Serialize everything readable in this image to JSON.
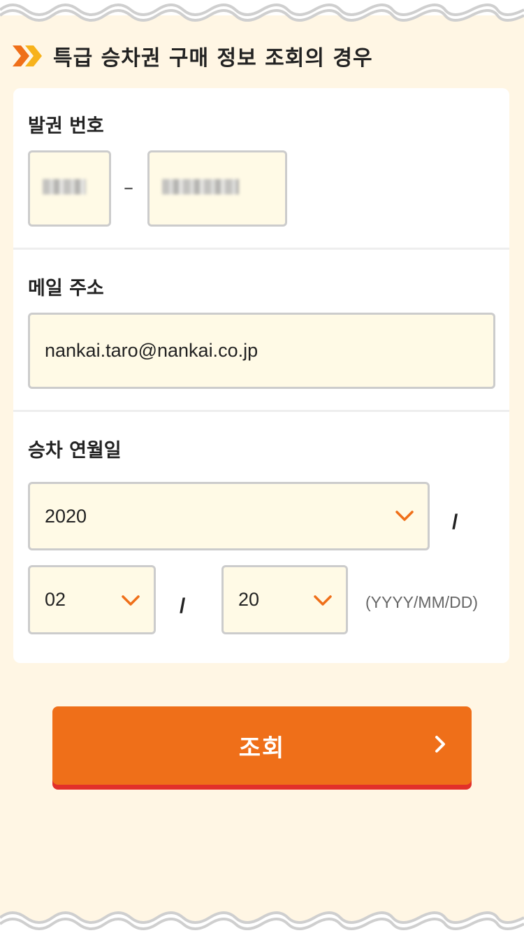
{
  "page": {
    "section_title": "특급 승차권 구매 정보 조회의 경우",
    "colors": {
      "accent": "#ef6f19",
      "accent_shadow": "#e2302a",
      "background": "#fff6e4",
      "field_bg": "#fffae6"
    }
  },
  "form": {
    "ticket_number": {
      "label": "발권 번호",
      "separator": "–",
      "part1_value": "",
      "part2_value": ""
    },
    "email": {
      "label": "메일 주소",
      "value": "nankai.taro@nankai.co.jp"
    },
    "boarding_date": {
      "label": "승차 연월일",
      "year": "2020",
      "month": "02",
      "day": "20",
      "separator": "/",
      "format_hint": "(YYYY/MM/DD)"
    }
  },
  "actions": {
    "submit_label": "조회"
  }
}
